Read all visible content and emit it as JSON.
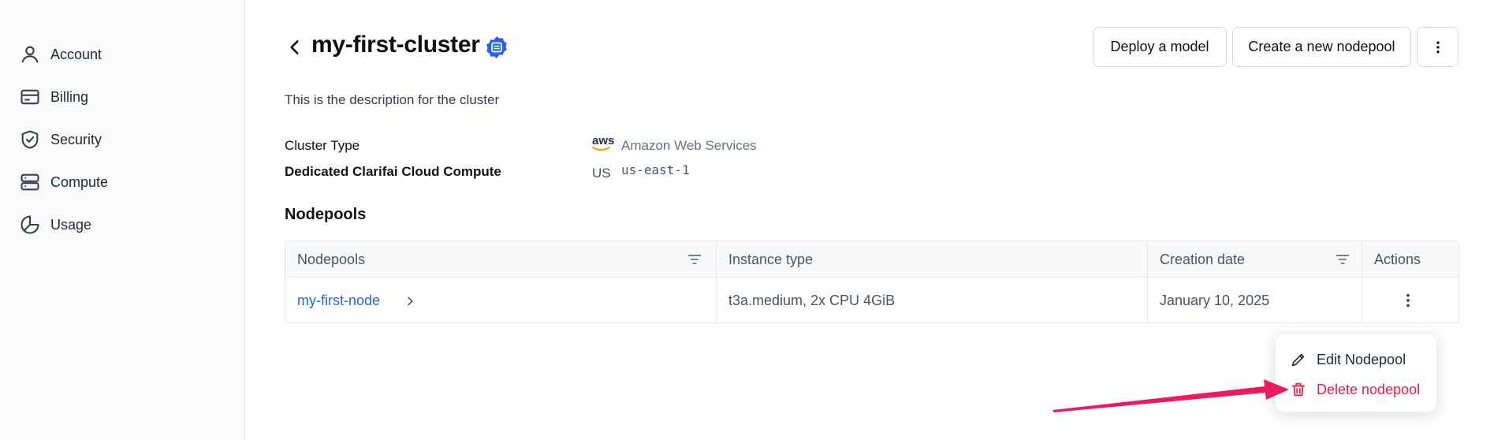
{
  "sidebar": {
    "items": [
      {
        "label": "Account",
        "icon": "user-icon"
      },
      {
        "label": "Billing",
        "icon": "credit-card-icon"
      },
      {
        "label": "Security",
        "icon": "shield-icon"
      },
      {
        "label": "Compute",
        "icon": "server-icon"
      },
      {
        "label": "Usage",
        "icon": "pie-chart-icon"
      }
    ]
  },
  "header": {
    "title": "my-first-cluster",
    "buttons": {
      "deploy": "Deploy a model",
      "create": "Create a new nodepool"
    }
  },
  "description": "This is the description for the cluster",
  "meta": {
    "cluster_type_label": "Cluster Type",
    "cluster_type_icon": "aws",
    "cluster_type_value": "Amazon Web Services",
    "compute_label": "Dedicated Clarifai Cloud Compute",
    "region_flag": "US",
    "region_value": "us-east-1"
  },
  "nodepools": {
    "heading": "Nodepools",
    "columns": [
      "Nodepools",
      "Instance type",
      "Creation date",
      "Actions"
    ],
    "rows": [
      {
        "name": "my-first-node",
        "instance": "t3a.medium, 2x CPU 4GiB",
        "created": "January 10, 2025"
      }
    ]
  },
  "context_menu": {
    "edit": "Edit Nodepool",
    "delete": "Delete nodepool"
  },
  "colors": {
    "accent": "#2563eb",
    "danger": "#e11d48",
    "annotation_arrow": "#ef1a5b"
  }
}
